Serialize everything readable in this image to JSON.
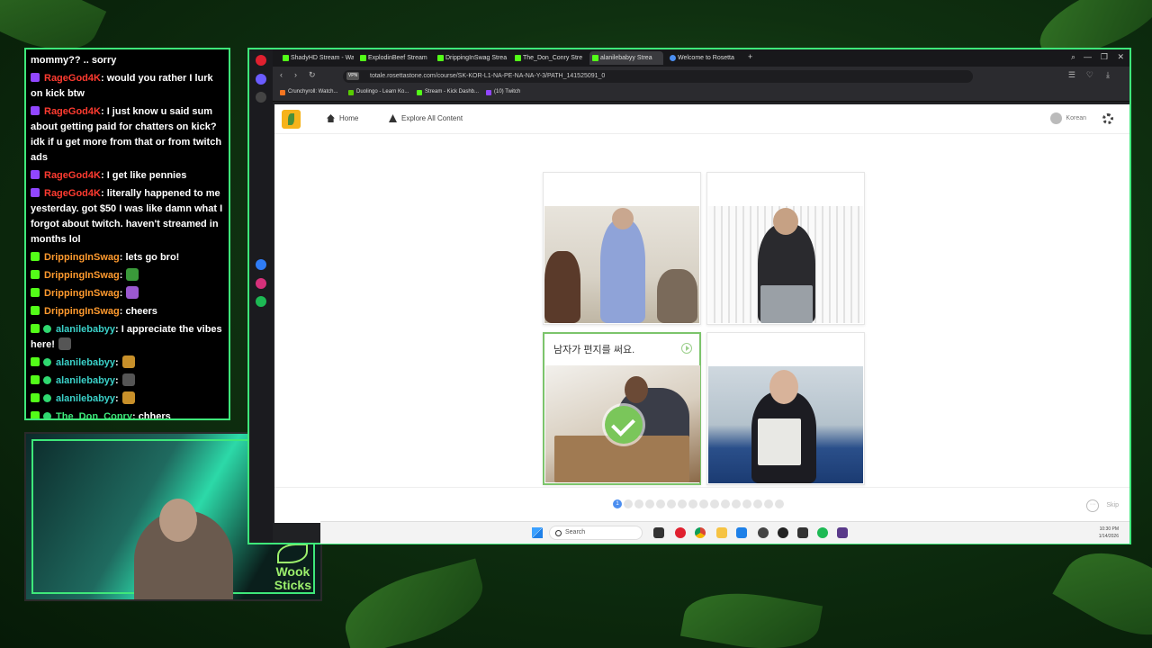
{
  "chat": {
    "messages": [
      {
        "user": "",
        "text": "mommy?? .. sorry",
        "badge": "none",
        "color": "#ffffff"
      },
      {
        "user": "RageGod4K",
        "text": ": would you rather I lurk on kick btw",
        "badge": "twitch",
        "color": "#ff3b30"
      },
      {
        "user": "RageGod4K",
        "text": ": I just know u said sum about getting paid for chatters on kick? idk if u get more from that or from twitch ads",
        "badge": "twitch",
        "color": "#ff3b30"
      },
      {
        "user": "RageGod4K",
        "text": ": I get like pennies",
        "badge": "twitch",
        "color": "#ff3b30"
      },
      {
        "user": "RageGod4K",
        "text": ": literally happened to me yesterday. got $50 I was like damn what I forgot about twitch. haven't streamed in months lol",
        "badge": "twitch",
        "color": "#ff3b30"
      },
      {
        "user": "DrippingInSwag",
        "text": ": lets go bro!",
        "badge": "kick",
        "color": "#ff9a2e"
      },
      {
        "user": "DrippingInSwag",
        "text": ":",
        "badge": "kick",
        "color": "#ff9a2e",
        "emote": "#3a9a3a"
      },
      {
        "user": "DrippingInSwag",
        "text": ":",
        "badge": "kick",
        "color": "#ff9a2e",
        "emote": "#9b59d0"
      },
      {
        "user": "DrippingInSwag",
        "text": ": cheers",
        "badge": "kick",
        "color": "#ff9a2e"
      },
      {
        "user": "alanilebabyy",
        "text": ": I appreciate the vibes here!",
        "badge": "kick-dot",
        "color": "#3ad0c8",
        "emote": "#555555"
      },
      {
        "user": "alanilebabyy",
        "text": ":",
        "badge": "kick-dot",
        "color": "#3ad0c8",
        "emote": "#c8902a"
      },
      {
        "user": "alanilebabyy",
        "text": ":",
        "badge": "kick-dot",
        "color": "#3ad0c8",
        "emote": "#555555"
      },
      {
        "user": "alanilebabyy",
        "text": ":",
        "badge": "kick-dot",
        "color": "#3ad0c8",
        "emote": "#c8902a"
      },
      {
        "user": "The_Don_Conry",
        "text": ": chhers",
        "badge": "kick-dot",
        "color": "#3ee87a"
      }
    ]
  },
  "webcam": {
    "overlay_logo_line1": "Wook",
    "overlay_logo_line2": "Sticks"
  },
  "browser": {
    "tabs": [
      {
        "label": "ShadyHD Stream - Wa",
        "active": false
      },
      {
        "label": "ExplodinBeef Stream",
        "active": false
      },
      {
        "label": "DrippingInSwag Strea",
        "active": false
      },
      {
        "label": "The_Don_Conry Stre",
        "active": false
      },
      {
        "label": "alanilebabyy Strea",
        "active": true
      },
      {
        "label": "Welcome to Rosetta",
        "active": false
      }
    ],
    "url": "totale.rosettastone.com/course/SK-KOR-L1-NA-PE-NA-NA-Y-3/PATH_141525091_0",
    "vpn_label": "VPN",
    "bookmarks": [
      "Crunchyroll: Watch...",
      "Duolingo - Learn Ko...",
      "Stream - Kick Dashb...",
      "(10) Twitch"
    ]
  },
  "site": {
    "nav_home": "Home",
    "nav_explore": "Explore All Content",
    "language": "Korean",
    "selected_caption": "남자가 편지를 써요.",
    "progress_current": "1",
    "progress_total_dots": 16,
    "skip_label": "Skip"
  },
  "taskbar": {
    "search_placeholder": "Search",
    "time": "10:30 PM",
    "date": "1/14/2026"
  },
  "colors": {
    "accent_green": "#3ee87a",
    "rosetta_yellow": "#f6b31b",
    "correct_green": "#7ac65a",
    "progress_blue": "#4b8ef0"
  }
}
